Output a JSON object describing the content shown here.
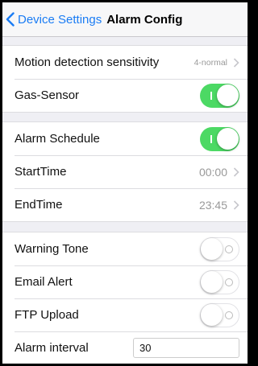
{
  "navbar": {
    "back_label": "Device Settings",
    "title": "Alarm Config"
  },
  "section1": {
    "motion": {
      "label": "Motion detection sensitivity",
      "value": "4-normal"
    },
    "gas": {
      "label": "Gas-Sensor",
      "enabled": true
    }
  },
  "section2": {
    "schedule": {
      "label": "Alarm Schedule",
      "enabled": true
    },
    "start": {
      "label": "StartTime",
      "value": "00:00"
    },
    "end": {
      "label": "EndTime",
      "value": "23:45"
    }
  },
  "section3": {
    "tone": {
      "label": "Warning Tone",
      "enabled": false
    },
    "email": {
      "label": "Email Alert",
      "enabled": false
    },
    "ftp": {
      "label": "FTP Upload",
      "enabled": false
    },
    "interval": {
      "label": "Alarm interval",
      "value": "30"
    }
  },
  "colors": {
    "accent": "#1a7cf4",
    "toggle_on": "#4cd964",
    "background": "#efeff4"
  }
}
